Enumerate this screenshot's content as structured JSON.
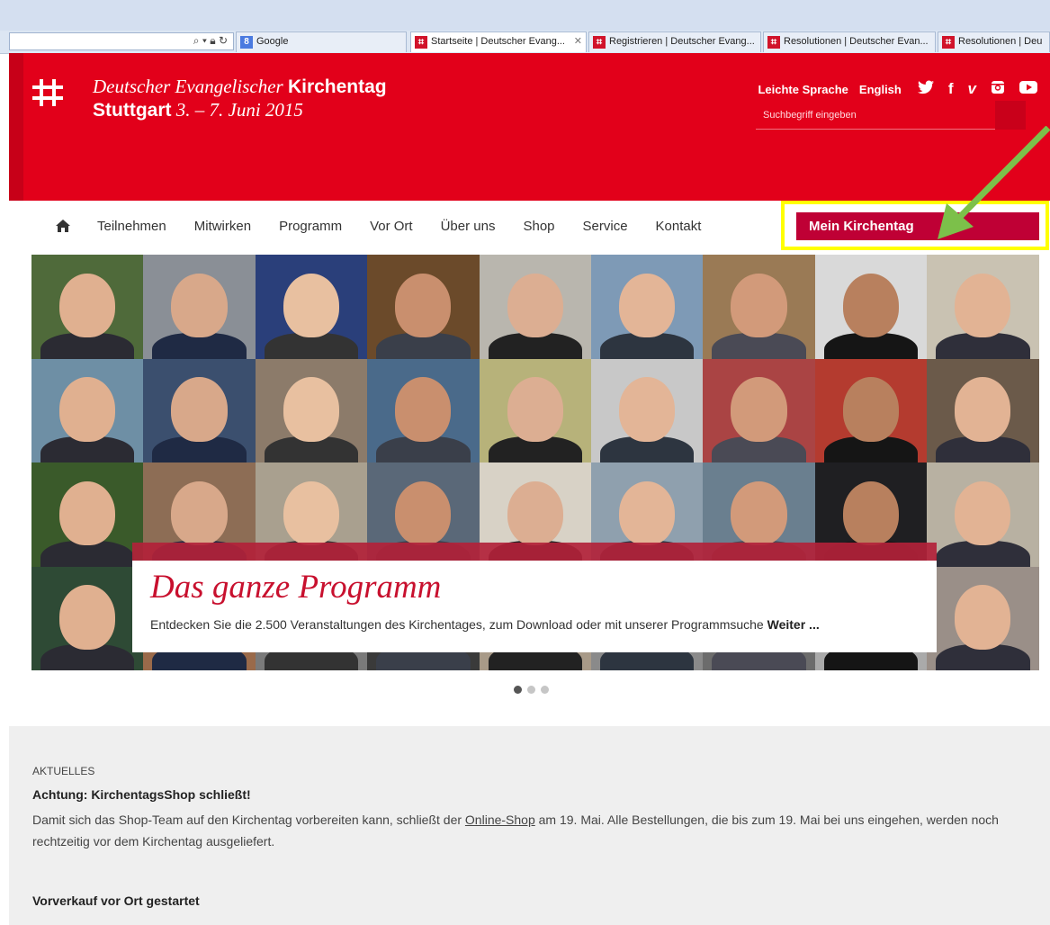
{
  "browser": {
    "search_engine_tab": "Google",
    "tabs": [
      {
        "label": "Startseite | Deutscher Evang..."
      },
      {
        "label": "Registrieren | Deutscher Evang..."
      },
      {
        "label": "Resolutionen | Deutscher Evan..."
      },
      {
        "label": "Resolutionen | Deu"
      }
    ]
  },
  "header": {
    "leichte_sprache": "Leichte Sprache",
    "english": "English",
    "brand_line1_italic": "Deutscher Evangelischer",
    "brand_line1_bold": "Kirchentag",
    "brand_line2_bold": "Stuttgart",
    "brand_line2_italic": "3. – 7. Juni 2015",
    "search_placeholder": "Suchbegriff eingeben",
    "social_icons": [
      "twitter-icon",
      "facebook-icon",
      "vimeo-icon",
      "instagram-icon",
      "youtube-icon"
    ]
  },
  "nav": {
    "items": [
      "Teilnehmen",
      "Mitwirken",
      "Programm",
      "Vor Ort",
      "Über uns",
      "Shop",
      "Service",
      "Kontakt"
    ],
    "mein_kirchentag": "Mein Kirchentag"
  },
  "slider": {
    "title": "Das ganze Programm",
    "text": "Entdecken Sie die 2.500 Veranstaltungen des Kirchentages, zum Download oder mit unserer Programmsuche",
    "link": "Weiter ...",
    "slide_count": 3,
    "active_slide": 1
  },
  "news": {
    "kicker": "AKTUELLES",
    "headline1": "Achtung: KirchentagsShop schließt!",
    "para_before": "Damit sich das Shop-Team auf den Kirchentag vorbereiten kann, schließt der ",
    "para_link": "Online-Shop",
    "para_after": " am 19. Mai. Alle Bestellungen, die bis zum 19. Mai bei uns eingehen, werden noch rechtzeitig vor dem Kirchentag ausgeliefert.",
    "headline2": "Vorverkauf vor Ort gestartet"
  },
  "colors": {
    "brand_red": "#e2001a",
    "mein_kirchentag_bg": "#bf0035",
    "highlight_yellow": "#ffff00",
    "arrow_green": "#7cc04a"
  }
}
